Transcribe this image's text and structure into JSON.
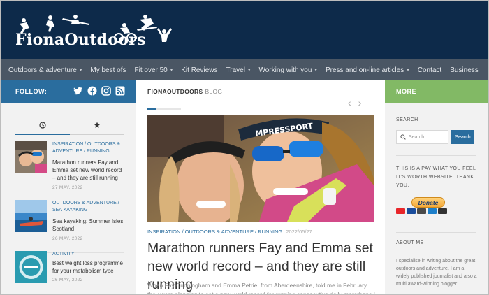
{
  "site": {
    "logo_text": "FionaOutdoors"
  },
  "nav": {
    "items": [
      {
        "label": "Outdoors & adventure",
        "dropdown": true
      },
      {
        "label": "My best ofs",
        "dropdown": false
      },
      {
        "label": "Fit over 50",
        "dropdown": true
      },
      {
        "label": "Kit Reviews",
        "dropdown": false
      },
      {
        "label": "Travel",
        "dropdown": true
      },
      {
        "label": "Working with you",
        "dropdown": true
      },
      {
        "label": "Press and on-line articles",
        "dropdown": true
      },
      {
        "label": "Contact",
        "dropdown": false
      },
      {
        "label": "Business",
        "dropdown": false
      }
    ]
  },
  "left": {
    "follow_label": "FOLLOW:",
    "social_icons": [
      "twitter-icon",
      "facebook-icon",
      "instagram-icon",
      "rss-icon"
    ],
    "tabs": [
      {
        "icon": "clock-icon"
      },
      {
        "icon": "star-icon"
      }
    ],
    "posts": [
      {
        "cats": "INSPIRATION / OUTDOORS & ADVENTURE / RUNNING",
        "title": "Marathon runners Fay and Emma set new world record – and they are still running",
        "date": "27 MAY, 2022"
      },
      {
        "cats": "OUTDOORS & ADVENTURE / SEA KAYAKING",
        "title": "Sea kayaking: Summer Isles, Scotland",
        "date": "26 MAY, 2022"
      },
      {
        "cats": "ACTIVITY",
        "title": "Best weight loss programme for your metabolism type",
        "date": "26 MAY, 2022"
      }
    ]
  },
  "center": {
    "header_bold": "FIONAOUTDOORS",
    "header_rest": "BLOG",
    "meta_cats": "INSPIRATION / OUTDOORS & ADVENTURE / RUNNING",
    "meta_date": "2022/05/27",
    "title": "Marathon runners Fay and Emma set new world record – and they are still running",
    "excerpt": "When Fay Cunningham and Emma Petrie, from Aberdeenshire, told me in February they were planning to set a new world record for running consecutive daily marathons I was"
  },
  "right": {
    "more_label": "MORE",
    "search_heading": "SEARCH",
    "search_placeholder": "Search ...",
    "search_button": "Search",
    "pay_text": "THIS IS A PAY WHAT YOU FEEL IT'S WORTH WEBSITE. THANK YOU.",
    "donate_label": "Donate",
    "about_heading": "ABOUT ME",
    "about_text": "I specialise in writing about the great outdoors and adventure. I am a widely published journalist and also a multi award-winning blogger."
  },
  "colors": {
    "header_bg": "#0d2a4a",
    "nav_bg": "#4a5664",
    "accent_blue": "#2a6d9e",
    "accent_green": "#82b965"
  }
}
